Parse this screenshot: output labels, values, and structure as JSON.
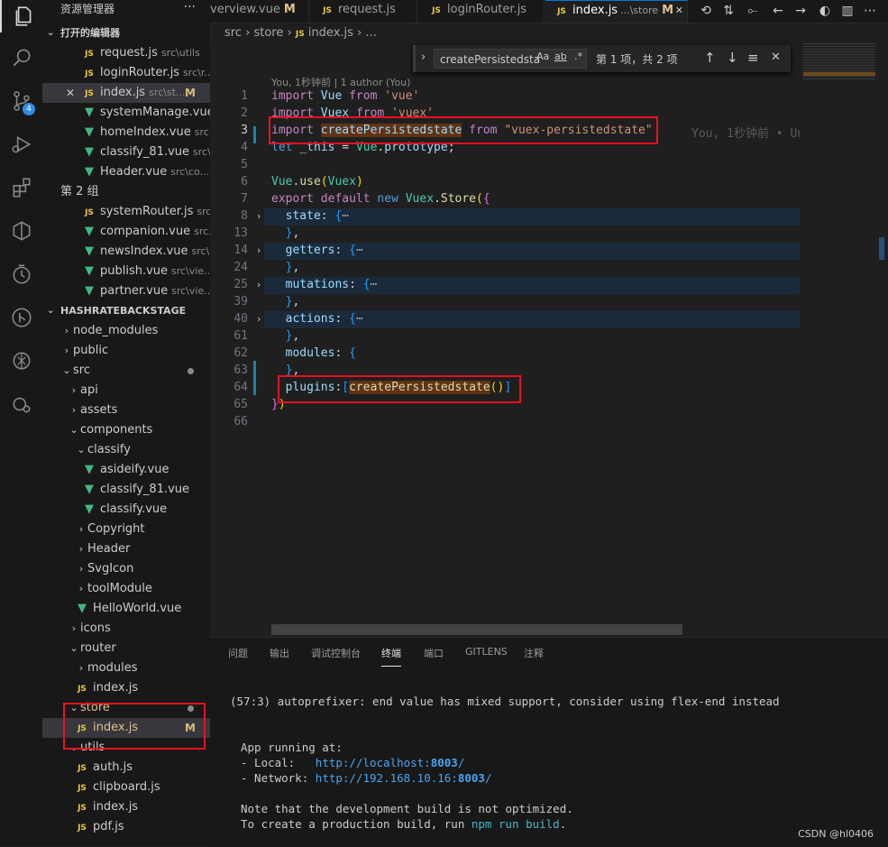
{
  "explorer": {
    "title": "资源管理器",
    "more": "···",
    "open_editors": {
      "label": "打开的编辑器",
      "items": [
        {
          "icon": "JS",
          "name": "request.js",
          "path": "src\\utils"
        },
        {
          "icon": "JS",
          "name": "loginRouter.js",
          "path": "src\\r..."
        },
        {
          "icon": "JS",
          "name": "index.js",
          "path": "src\\st...",
          "status": "M",
          "close": "✕"
        },
        {
          "icon": "V",
          "name": "systemManage.vue...",
          "path": ""
        },
        {
          "icon": "V",
          "name": "homeIndex.vue",
          "path": "src..."
        },
        {
          "icon": "V",
          "name": "classify_81.vue",
          "path": "src\\c..."
        },
        {
          "icon": "V",
          "name": "Header.vue",
          "path": "src\\co..."
        }
      ],
      "group2": "第 2 组",
      "items2": [
        {
          "icon": "JS",
          "name": "systemRouter.js",
          "path": "src..."
        },
        {
          "icon": "V",
          "name": "companion.vue",
          "path": "src..."
        },
        {
          "icon": "V",
          "name": "newsIndex.vue",
          "path": "src\\..."
        },
        {
          "icon": "V",
          "name": "publish.vue",
          "path": "src\\vie..."
        },
        {
          "icon": "V",
          "name": "partner.vue",
          "path": "src\\vie..."
        }
      ]
    },
    "project": {
      "label": "HASHRATEBACKSTAGE",
      "tree": [
        {
          "name": "node_modules",
          "type": "folder"
        },
        {
          "name": "public",
          "type": "folder"
        },
        {
          "name": "src",
          "type": "folder-open"
        },
        {
          "name": "api",
          "type": "folder"
        },
        {
          "name": "assets",
          "type": "folder"
        },
        {
          "name": "components",
          "type": "folder-open"
        },
        {
          "name": "classify",
          "type": "folder-open"
        },
        {
          "name": "asideify.vue",
          "type": "vue"
        },
        {
          "name": "classify_81.vue",
          "type": "vue"
        },
        {
          "name": "classify.vue",
          "type": "vue"
        },
        {
          "name": "Copyright",
          "type": "folder"
        },
        {
          "name": "Header",
          "type": "folder"
        },
        {
          "name": "SvgIcon",
          "type": "folder"
        },
        {
          "name": "toolModule",
          "type": "folder"
        },
        {
          "name": "HelloWorld.vue",
          "type": "vue"
        },
        {
          "name": "icons",
          "type": "folder"
        },
        {
          "name": "router",
          "type": "folder-open"
        },
        {
          "name": "modules",
          "type": "folder"
        },
        {
          "name": "index.js",
          "type": "js"
        },
        {
          "name": "store",
          "type": "folder-open"
        },
        {
          "name": "index.js",
          "type": "js",
          "status": "M"
        },
        {
          "name": "utils",
          "type": "folder-open"
        },
        {
          "name": "auth.js",
          "type": "js"
        },
        {
          "name": "clipboard.js",
          "type": "js"
        },
        {
          "name": "index.js",
          "type": "js"
        },
        {
          "name": "pdf.js",
          "type": "js"
        }
      ]
    }
  },
  "tabs": [
    {
      "name": "verview.vue",
      "status": "M",
      "icon": ""
    },
    {
      "name": "request.js",
      "icon": "JS"
    },
    {
      "name": "loginRouter.js",
      "icon": "JS"
    },
    {
      "name": "index.js",
      "path": "...\\store",
      "status": "M",
      "icon": "JS",
      "close": "✕"
    }
  ],
  "breadcrumb": {
    "parts": [
      "src",
      "store",
      "index.js",
      "..."
    ],
    "sep": "›",
    "icon": "JS"
  },
  "find": {
    "value": "createPersistedsta",
    "match_case": "Aa",
    "whole_word": "ab",
    "regex": ".*",
    "count": "第 1 项，共 2 项",
    "prev": "↑",
    "next": "↓",
    "menu": "≡",
    "close": "✕",
    "toggle": "›"
  },
  "editor": {
    "blame_header": "You, 1秒钟前 | 1 author (You)",
    "inline_blame": "You, 1秒钟前 • Un",
    "line_numbers": [
      "1",
      "2",
      "3",
      "4",
      "5",
      "6",
      "7",
      "8",
      "13",
      "14",
      "24",
      "25",
      "39",
      "40",
      "61",
      "62",
      "63",
      "64",
      "65",
      "66"
    ],
    "ellipsis": "⋯"
  },
  "panel": {
    "tabs": [
      "问题",
      "输出",
      "调试控制台",
      "终端",
      "端口",
      "GITLENS",
      "注释"
    ],
    "active_tab": "终端",
    "warning": "(57:3) autoprefixer: end value has mixed support, consider using flex-end instead",
    "app_running": "App running at:",
    "local_label": "- Local:   ",
    "local_url_prefix": "http://localhost:",
    "local_port": "8003",
    "network_label": "- Network: ",
    "network_url_prefix": "http://192.168.10.16:",
    "network_port": "8003",
    "note": "Note that the development build is not optimized.",
    "build_prefix": "To create a production build, run ",
    "build_cmd": "npm run build",
    "build_suffix": "."
  },
  "watermark": "CSDN @hl0406",
  "colors": {
    "accent": "#0078d4",
    "highlight_box": "#e81123",
    "modified": "#e2c08d"
  }
}
